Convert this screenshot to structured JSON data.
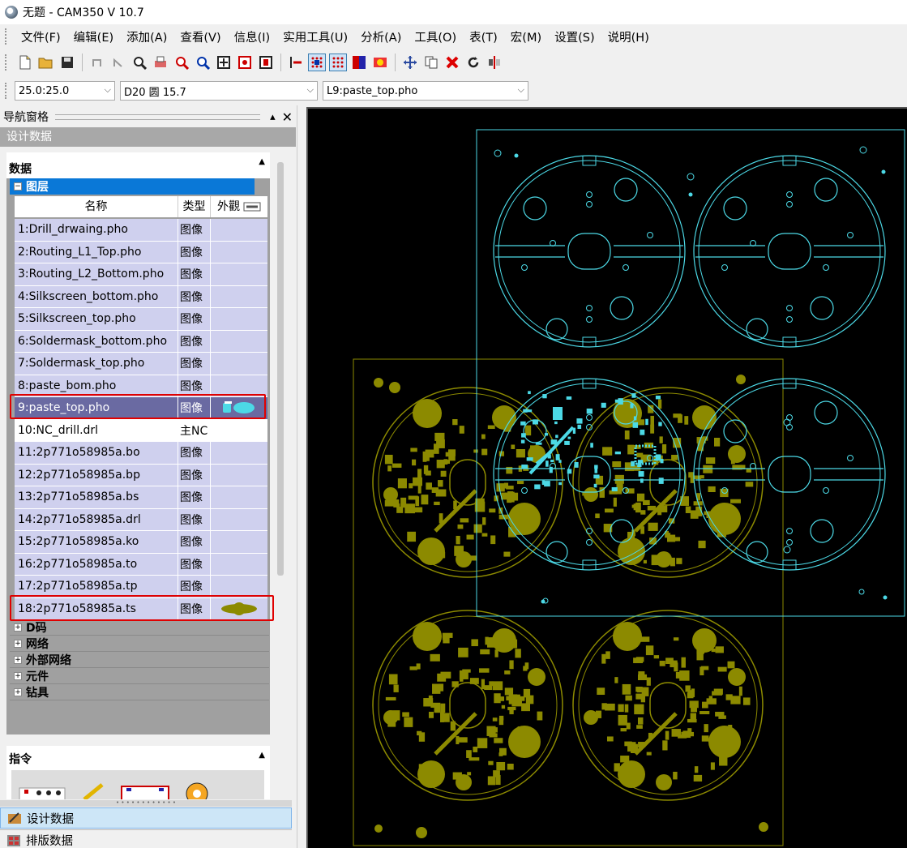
{
  "window": {
    "title": "无题 - CAM350 V 10.7"
  },
  "menu": [
    "文件(F)",
    "编辑(E)",
    "添加(A)",
    "查看(V)",
    "信息(I)",
    "实用工具(U)",
    "分析(A)",
    "工具(O)",
    "表(T)",
    "宏(M)",
    "设置(S)",
    "说明(H)"
  ],
  "combos": {
    "grid": "25.0:25.0",
    "dcode": "D20  圆 15.7",
    "layer": "L9:paste_top.pho"
  },
  "nav": {
    "title": "导航窗格",
    "subtitle": "设计数据",
    "data_header": "数据",
    "layers_header": "图层",
    "columns": {
      "name": "名称",
      "type": "类型",
      "appearance": "外觀"
    },
    "layers": [
      {
        "name": "1:Drill_drwaing.pho",
        "type": "图像"
      },
      {
        "name": "2:Routing_L1_Top.pho",
        "type": "图像"
      },
      {
        "name": "3:Routing_L2_Bottom.pho",
        "type": "图像"
      },
      {
        "name": "4:Silkscreen_bottom.pho",
        "type": "图像"
      },
      {
        "name": "5:Silkscreen_top.pho",
        "type": "图像"
      },
      {
        "name": "6:Soldermask_bottom.pho",
        "type": "图像"
      },
      {
        "name": "7:Soldermask_top.pho",
        "type": "图像"
      },
      {
        "name": "8:paste_bom.pho",
        "type": "图像"
      },
      {
        "name": "9:paste_top.pho",
        "type": "图像"
      },
      {
        "name": "10:NC_drill.drl",
        "type": "主NC"
      },
      {
        "name": "11:2p771o58985a.bo",
        "type": "图像"
      },
      {
        "name": "12:2p771o58985a.bp",
        "type": "图像"
      },
      {
        "name": "13:2p771o58985a.bs",
        "type": "图像"
      },
      {
        "name": "14:2p771o58985a.drl",
        "type": "图像"
      },
      {
        "name": "15:2p771o58985a.ko",
        "type": "图像"
      },
      {
        "name": "16:2p771o58985a.to",
        "type": "图像"
      },
      {
        "name": "17:2p771o58985a.tp",
        "type": "图像"
      },
      {
        "name": "18:2p771o58985a.ts",
        "type": "图像"
      }
    ],
    "tree": [
      "D码",
      "网络",
      "外部网络",
      "元件",
      "钻具"
    ],
    "commands_header": "指令",
    "tabs": [
      "设计数据",
      "排版数据"
    ]
  },
  "colors": {
    "routing": "#4cd9e6",
    "paste": "#8c8a00",
    "selection": "#6a6aa2",
    "highlight": "#e00000",
    "layer_header": "#0a78d7"
  }
}
